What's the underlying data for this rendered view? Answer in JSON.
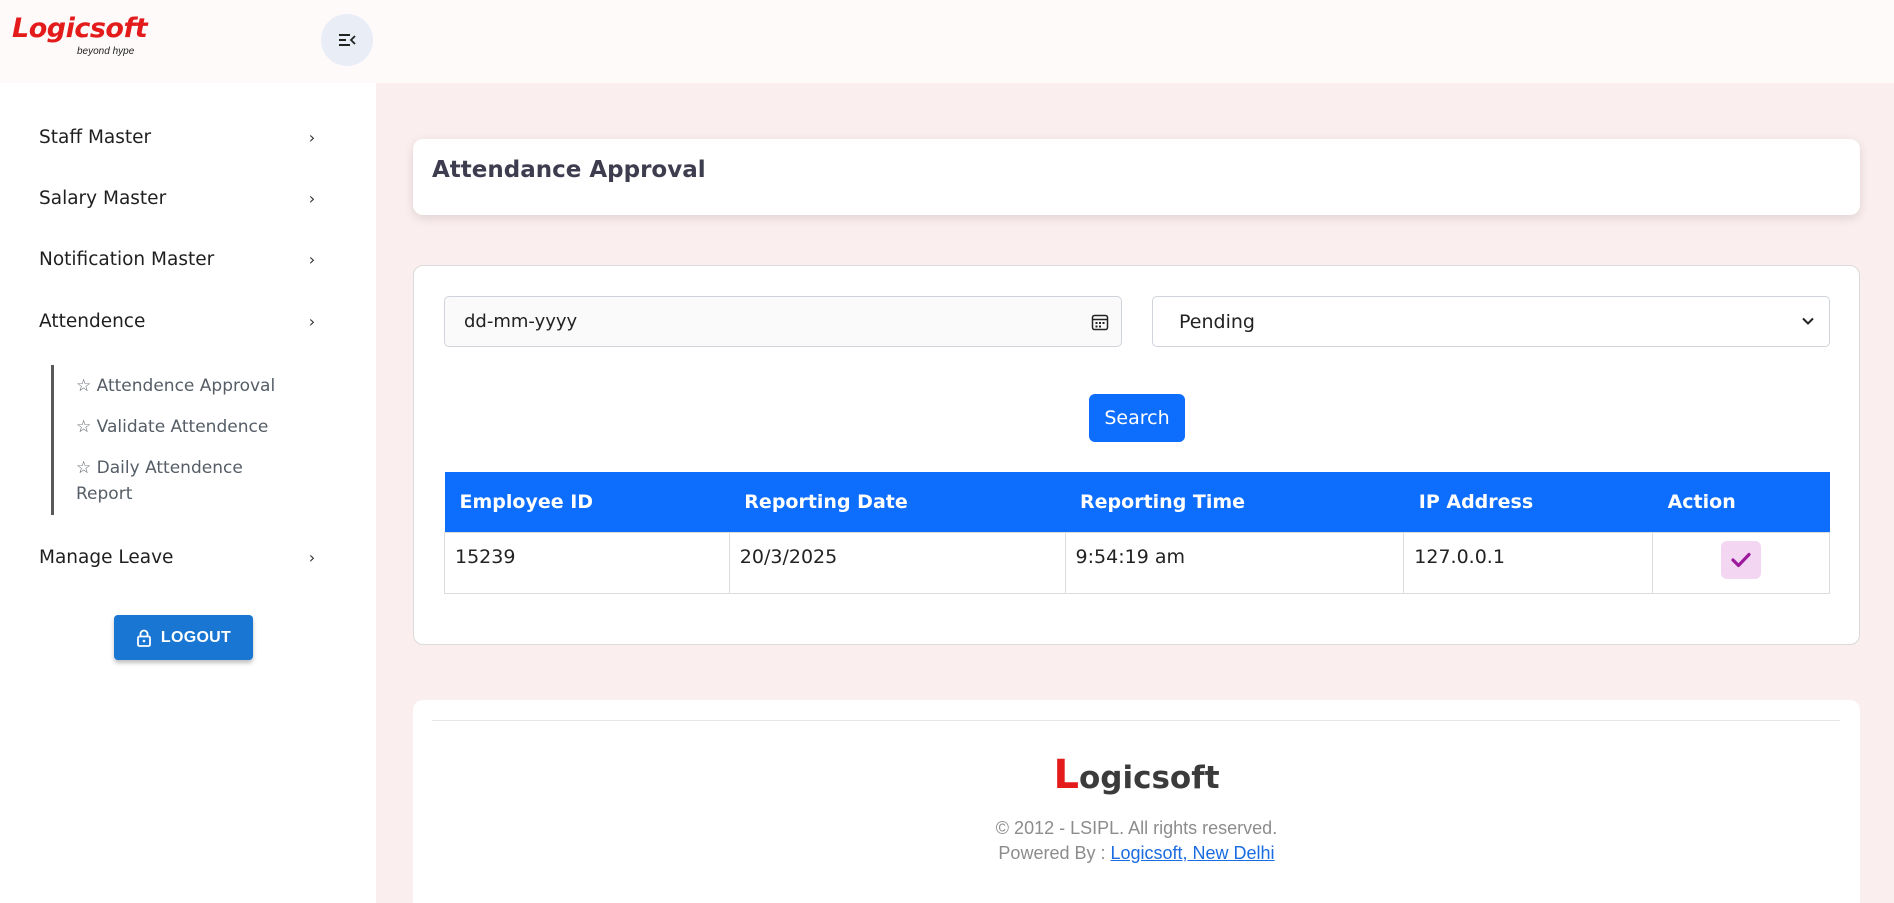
{
  "brand": {
    "name": "Logicsoft",
    "tagline": "beyond hype"
  },
  "sidebar": {
    "items": [
      {
        "label": "Staff Master"
      },
      {
        "label": "Salary Master"
      },
      {
        "label": "Notification Master"
      },
      {
        "label": "Attendence"
      },
      {
        "label": "Manage Leave"
      }
    ],
    "submenu": [
      {
        "label": "☆ Attendence Approval"
      },
      {
        "label": "☆ Validate Attendence"
      },
      {
        "label": "☆ Daily Attendence Report"
      }
    ],
    "logout_label": "LOGOUT"
  },
  "page": {
    "title": "Attendance Approval"
  },
  "filters": {
    "date_placeholder": "dd-mm-yyyy",
    "status_selected": "Pending",
    "search_label": "Search"
  },
  "table": {
    "headers": [
      "Employee ID",
      "Reporting Date",
      "Reporting Time",
      "IP Address",
      "Action"
    ],
    "rows": [
      {
        "employee_id": "15239",
        "reporting_date": "20/3/2025",
        "reporting_time": "9:54:19 am",
        "ip_address": "127.0.0.1"
      }
    ]
  },
  "footer": {
    "logo_initial": "L",
    "logo_rest": "ogicsoft",
    "copyright": "© 2012 - LSIPL. All rights reserved.",
    "powered_prefix": "Powered By : ",
    "powered_link": "Logicsoft, New Delhi"
  },
  "colors": {
    "primary": "#0d6efd",
    "logout": "#1976d2",
    "brand_red": "#e31b1b",
    "page_bg": "#fbeeee"
  }
}
